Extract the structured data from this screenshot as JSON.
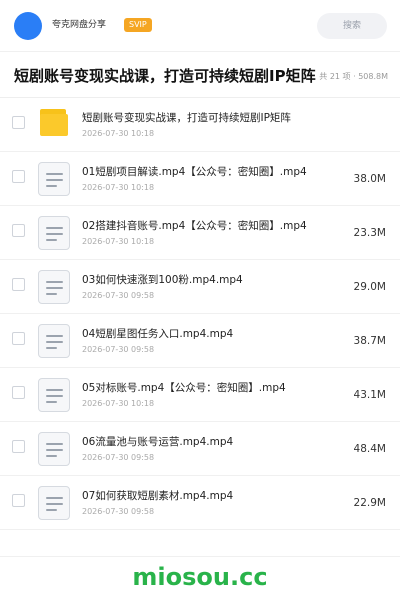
{
  "header": {
    "site_name": "夸克网盘分享",
    "badge": "SVIP",
    "search_placeholder": "搜索"
  },
  "folder": {
    "title": "短剧账号变现实战课，打造可持续短剧IP矩阵",
    "meta": "共 21 项 · 508.8M"
  },
  "items": [
    {
      "type": "folder",
      "name": "短剧账号变现实战课，打造可持续短剧IP矩阵",
      "date": "2026-07-30 10:18",
      "size": ""
    },
    {
      "type": "file",
      "name": "01短剧项目解读.mp4【公众号：密知圈】.mp4",
      "date": "2026-07-30 10:18",
      "size": "38.0M"
    },
    {
      "type": "file",
      "name": "02搭建抖音账号.mp4【公众号：密知圈】.mp4",
      "date": "2026-07-30 10:18",
      "size": "23.3M"
    },
    {
      "type": "file",
      "name": "03如何快速涨到100粉.mp4.mp4",
      "date": "2026-07-30 09:58",
      "size": "29.0M"
    },
    {
      "type": "file",
      "name": "04短剧星图任务入口.mp4.mp4",
      "date": "2026-07-30 09:58",
      "size": "38.7M"
    },
    {
      "type": "file",
      "name": "05对标账号.mp4【公众号：密知圈】.mp4",
      "date": "2026-07-30 10:18",
      "size": "43.1M"
    },
    {
      "type": "file",
      "name": "06流量池与账号运营.mp4.mp4",
      "date": "2026-07-30 09:58",
      "size": "48.4M"
    },
    {
      "type": "file",
      "name": "07如何获取短剧素材.mp4.mp4",
      "date": "2026-07-30 09:58",
      "size": "22.9M"
    }
  ],
  "watermark": "miosou.cc",
  "colors": {
    "avatar": "#2a7ef6",
    "badge": "#f5a623",
    "folder_icon": "#fbc92b",
    "watermark": "#29b34a"
  },
  "icons": {
    "folder": "folder-icon",
    "file": "file-icon"
  }
}
